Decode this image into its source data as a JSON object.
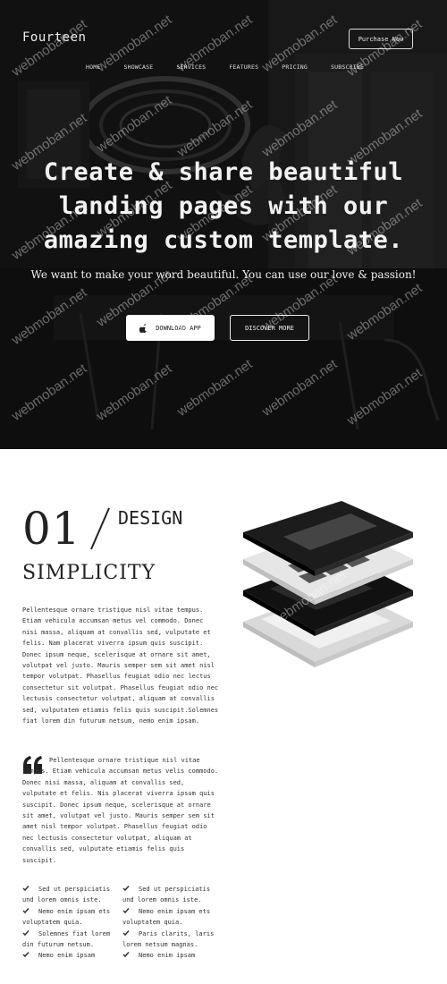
{
  "header": {
    "brand": "Fourteen",
    "purchase_label": "Purchase Now"
  },
  "nav": {
    "items": [
      "HOME",
      "SHOWCASE",
      "SERVICES",
      "FEATURES",
      "PRICING",
      "SUBSCRIBE"
    ]
  },
  "hero": {
    "title": "Create & share beautiful landing pages with our amazing custom template.",
    "subtitle": "We want to make your word beautiful. You can use our love & passion!",
    "download_label": "DOWNLOAD APP",
    "discover_label": "DISCOVER MORE"
  },
  "feature": {
    "number": "01",
    "heading": "DESIGN",
    "subheading": "SIMPLICITY",
    "paragraph": "Pellentesque ornare tristique nisl vitae tempus. Etiam vehicula accumsan metus vel commodo. Donec nisi massa, aliquam at convallis sed, vulputate et felis. Nam placerat viverra ipsum quis suscipit. Donec ipsum neque, scelerisque at ornare sit amet, volutpat vel justo. Mauris semper sem sit amet nisl tempor volutpat. Phasellus feugiat odio nec lectus consectetur sit volutpat. Phasellus feugiat odio nec lectusis consectetur volutpat, aliquam at convallis sed, vulputatem etiamis felis quis suscipit.Solemnes fiat lorem din futurum netsum, nemo enim ipsam.",
    "quote": "Pellentesque ornare tristique nisl vitae tempus. Etiam vehicula accumsan metus velis commodo. Donec nisi massa, aliquam at convallis sed, vulputate et felis. Nis placerat viverra ipsum quis suscipit. Donec ipsum neque, scelerisque at ornare sit amet, volutpat vel justo. Mauris semper sem sit amet nisl tempor volutpat. Phasellus feugiat odio nec lectusis consectetur volutpat, aliquam at convallis sed, vulputate etiamis felis quis suscipit.",
    "checklist": [
      "Sed ut perspiciatis und lorem omnis iste.",
      "Sed ut perspiciatis und lorem omnis iste.",
      "Nemo enim ipsam ets voluptatem quia.",
      "Nemo enim ipsam ets voluptatem quia.",
      "Solemnes fiat lorem din futurum netsum.",
      "Paris clarits, laris lorem netsum magnas.",
      "Nemo enim ipsam",
      "Nemo enim ipsam"
    ]
  },
  "watermark": "webmoban.net",
  "colors": {
    "hero_bg": "#1a1a1a",
    "text_dark": "#222222",
    "text_light": "#eeeeee",
    "page_bg": "#ffffff"
  },
  "icons": {
    "download": "apple-icon",
    "quote": "quote-icon",
    "check": "check-icon"
  }
}
